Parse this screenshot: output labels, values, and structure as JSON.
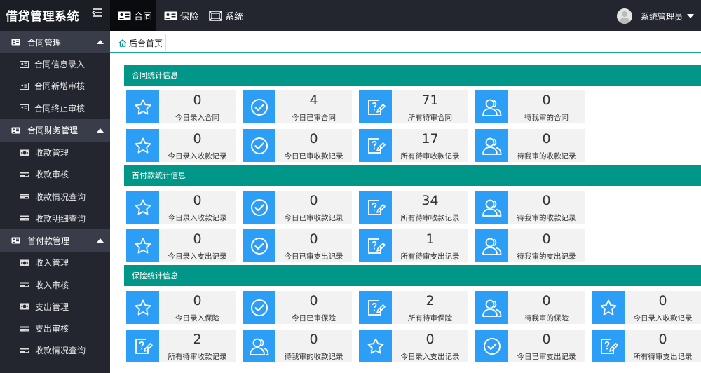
{
  "brand": {
    "title": "借贷管理系统"
  },
  "top_tabs": [
    {
      "label": "合同"
    },
    {
      "label": "保险"
    },
    {
      "label": "系统"
    }
  ],
  "user": {
    "name": "系统管理员"
  },
  "sidebar": {
    "groups": [
      {
        "label": "合同管理",
        "items": [
          "合同信息录入",
          "合同新增审核",
          "合同终止审核"
        ]
      },
      {
        "label": "合同财务管理",
        "items": [
          "收款管理",
          "收款审核",
          "收款情况查询",
          "收款明细查询"
        ]
      },
      {
        "label": "首付款管理",
        "items": [
          "收入管理",
          "收入审核",
          "支出管理",
          "支出审核",
          "收款情况查询"
        ]
      }
    ]
  },
  "breadcrumb": {
    "home": "后台首页"
  },
  "sections": [
    {
      "title": "合同统计信息",
      "rows": [
        [
          {
            "icon": "star",
            "value": "0",
            "label": "今日录入合同"
          },
          {
            "icon": "check",
            "value": "4",
            "label": "今日已审合同"
          },
          {
            "icon": "edit",
            "value": "71",
            "label": "所有待审合同"
          },
          {
            "icon": "users",
            "value": "0",
            "label": "待我审的合同"
          }
        ],
        [
          {
            "icon": "star",
            "value": "0",
            "label": "今日录入收款记录"
          },
          {
            "icon": "check",
            "value": "0",
            "label": "今日已审收款记录"
          },
          {
            "icon": "edit",
            "value": "17",
            "label": "所有待审收款记录"
          },
          {
            "icon": "users",
            "value": "0",
            "label": "待我审的收款记录"
          }
        ]
      ]
    },
    {
      "title": "首付款统计信息",
      "rows": [
        [
          {
            "icon": "star",
            "value": "0",
            "label": "今日录入收款记录"
          },
          {
            "icon": "check",
            "value": "0",
            "label": "今日已审收款记录"
          },
          {
            "icon": "edit",
            "value": "34",
            "label": "所有待审收款记录"
          },
          {
            "icon": "users",
            "value": "0",
            "label": "待我审的收款记录"
          }
        ],
        [
          {
            "icon": "star",
            "value": "0",
            "label": "今日录入支出记录"
          },
          {
            "icon": "check",
            "value": "0",
            "label": "今日已审支出记录"
          },
          {
            "icon": "edit",
            "value": "1",
            "label": "所有待审支出记录"
          },
          {
            "icon": "users",
            "value": "0",
            "label": "待我审的支出记录"
          }
        ]
      ]
    },
    {
      "title": "保险统计信息",
      "rows": [
        [
          {
            "icon": "star",
            "value": "0",
            "label": "今日录入保险"
          },
          {
            "icon": "check",
            "value": "0",
            "label": "今日已审保险"
          },
          {
            "icon": "edit",
            "value": "2",
            "label": "所有待审保险"
          },
          {
            "icon": "users",
            "value": "0",
            "label": "待我审的保险"
          },
          {
            "icon": "star",
            "value": "0",
            "label": "今日录入收款记录"
          }
        ],
        [
          {
            "icon": "edit",
            "value": "2",
            "label": "所有待审收款记录"
          },
          {
            "icon": "users",
            "value": "0",
            "label": "待我审的收款记录"
          },
          {
            "icon": "star",
            "value": "0",
            "label": "今日录入支出记录"
          },
          {
            "icon": "check",
            "value": "0",
            "label": "今日已审支出记录"
          },
          {
            "icon": "edit",
            "value": "0",
            "label": "所有待审支出记录"
          }
        ]
      ]
    }
  ],
  "colors": {
    "topbar": "#23262e",
    "sidebar": "#23262e",
    "sidebar_group": "#393d49",
    "accent": "#009688",
    "icon_bg": "#2d9ef5",
    "card_bg": "#f2f2f2"
  }
}
